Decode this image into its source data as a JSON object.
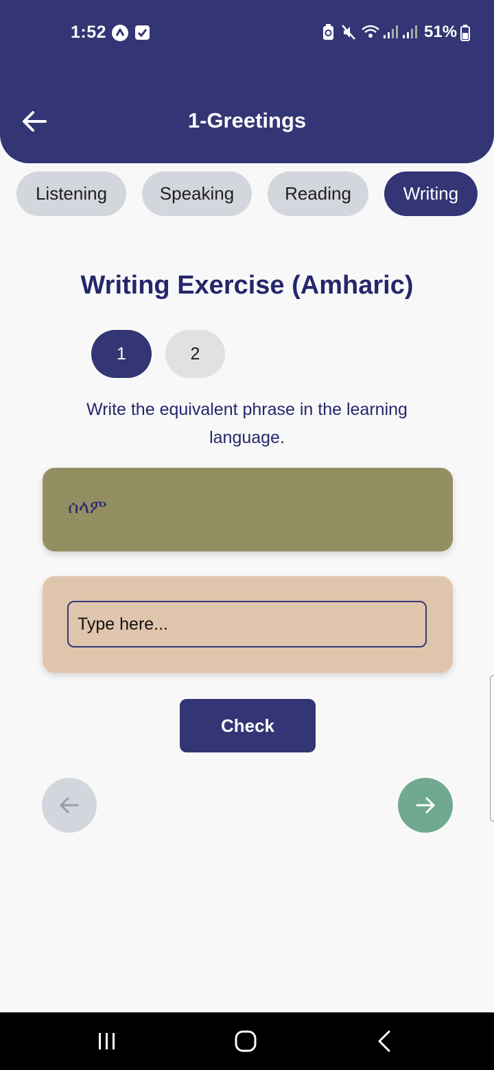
{
  "status_bar": {
    "time": "1:52",
    "battery_percent": "51%",
    "icons": [
      "app-notification-icon",
      "checkbox-notification-icon",
      "battery-saver-icon",
      "mute-icon",
      "wifi-icon",
      "signal-icon",
      "signal-icon",
      "battery-icon"
    ]
  },
  "header": {
    "title": "1-Greetings",
    "back_icon": "arrow-left-icon"
  },
  "tabs": [
    {
      "label": "Listening",
      "active": false
    },
    {
      "label": "Speaking",
      "active": false
    },
    {
      "label": "Reading",
      "active": false
    },
    {
      "label": "Writing",
      "active": true
    }
  ],
  "exercise": {
    "title": "Writing Exercise (Amharic)",
    "steps": [
      {
        "label": "1",
        "active": true
      },
      {
        "label": "2",
        "active": false
      }
    ],
    "instruction": "Write the equivalent phrase in the learning language.",
    "prompt": "ሰላም",
    "answer": {
      "value": "",
      "placeholder": "Type here..."
    },
    "check_label": "Check"
  },
  "navigation": {
    "prev_icon": "arrow-left-icon",
    "next_icon": "arrow-right-icon"
  },
  "colors": {
    "primary": "#333574",
    "prompt_card": "#948f63",
    "answer_card": "#e0c5ad",
    "next_button": "#6ea990",
    "tab_inactive": "#d4d6dd"
  },
  "system_nav": [
    "recents-icon",
    "home-icon",
    "back-icon"
  ]
}
